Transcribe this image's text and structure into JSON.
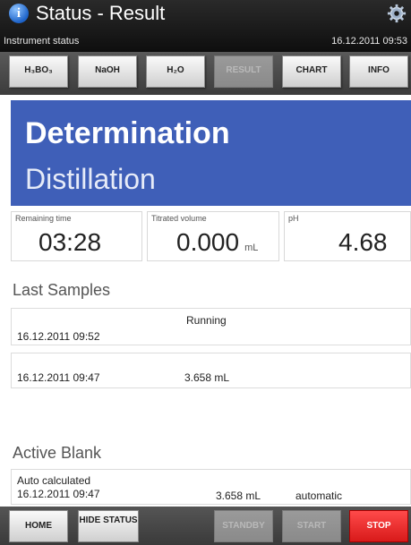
{
  "header": {
    "title": "Status - Result",
    "subtitle": "Instrument status",
    "datetime": "16.12.2011 09:53"
  },
  "tabs": [
    {
      "label": "H₃BO₃",
      "enabled": true
    },
    {
      "label": "NaOH",
      "enabled": true
    },
    {
      "label": "H₂O",
      "enabled": true
    },
    {
      "label": "RESULT",
      "enabled": false
    },
    {
      "label": "CHART",
      "enabled": true
    },
    {
      "label": "INFO",
      "enabled": true
    }
  ],
  "banner": {
    "line1": "Determination",
    "line2": "Distillation",
    "color": "#3f5fb8"
  },
  "values": {
    "remaining": {
      "label": "Remaining time",
      "value": "03:28"
    },
    "titrated": {
      "label": "Titrated volume",
      "value": "0.000",
      "unit": "mL"
    },
    "ph": {
      "label": "pH",
      "value": "4.68"
    }
  },
  "last_samples": {
    "title": "Last Samples",
    "rows": [
      {
        "status": "Running",
        "date": "16.12.2011 09:52"
      },
      {
        "date": "16.12.2011 09:47",
        "volume": "3.658 mL"
      }
    ]
  },
  "active_blank": {
    "title": "Active Blank",
    "label": "Auto calculated",
    "date": "16.12.2011 09:47",
    "volume": "3.658 mL",
    "mode": "automatic"
  },
  "footer": {
    "home": "HOME",
    "hide_status": "HIDE STATUS",
    "standby": "STANDBY",
    "start": "START",
    "stop": "STOP"
  },
  "icons": {
    "info": "info-icon",
    "settings": "gear-icon"
  }
}
